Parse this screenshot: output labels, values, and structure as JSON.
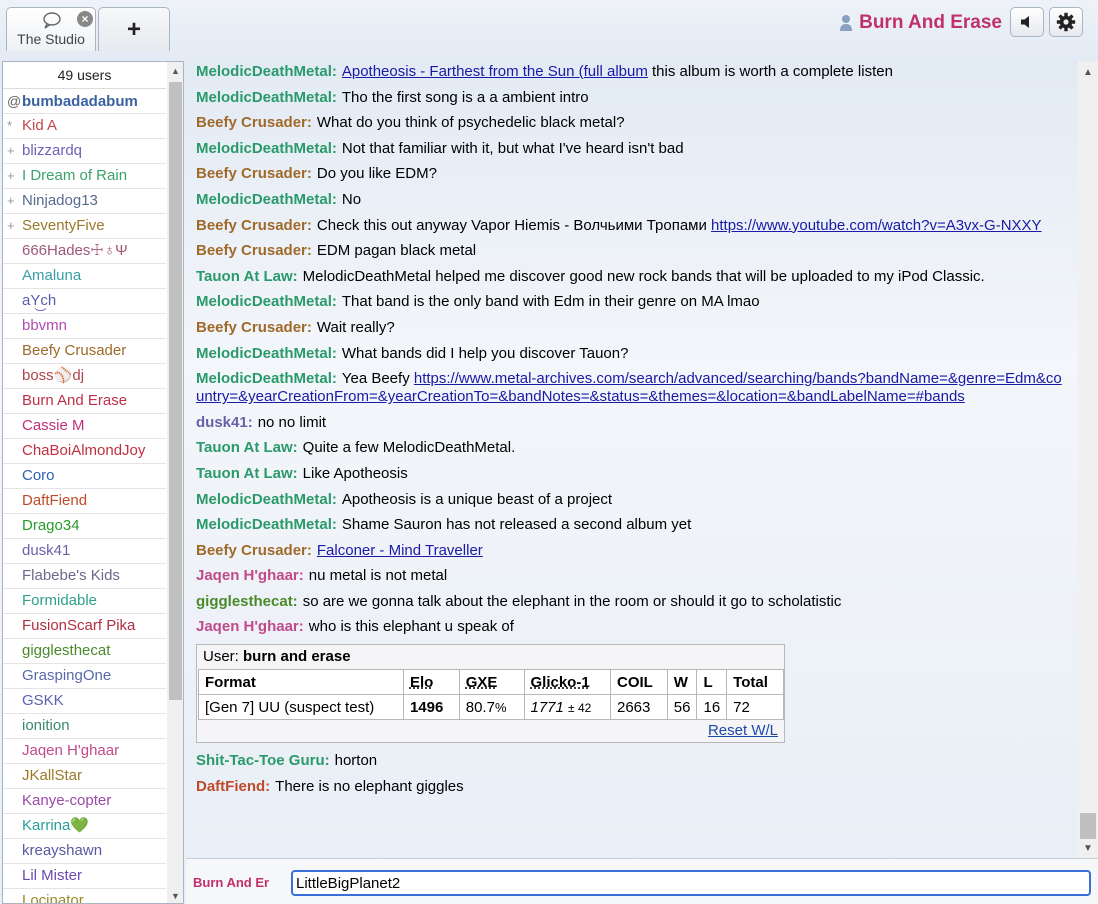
{
  "tabs": [
    {
      "label": "The Studio",
      "icon": "chat-bubble-icon",
      "close": "×"
    },
    {
      "label": "+",
      "icon": "plus-icon"
    }
  ],
  "header": {
    "username": "Burn And Erase",
    "username_color": "#c0306a",
    "sound_icon": "speaker-icon",
    "settings_icon": "gear-icon"
  },
  "userlist": {
    "count_label": "49 users",
    "users": [
      {
        "rank": "@",
        "name": "bumbadadabum",
        "color": "#3b63a0",
        "bold": true
      },
      {
        "rank": "*",
        "name": "Kid A",
        "color": "#c34848"
      },
      {
        "rank": "+",
        "name": "blizzardq",
        "color": "#6b62b8"
      },
      {
        "rank": "+",
        "name": "I Dream of Rain",
        "color": "#3aa36b"
      },
      {
        "rank": "+",
        "name": "Ninjadog13",
        "color": "#5b6a93"
      },
      {
        "rank": "+",
        "name": "SeventyFive",
        "color": "#9a7a2a"
      },
      {
        "rank": "",
        "name": "666Hades☩♁Ψ",
        "color": "#a0587a"
      },
      {
        "rank": "",
        "name": "Amaluna",
        "color": "#3aa0a8"
      },
      {
        "rank": "",
        "name": "aY͜ch",
        "color": "#5b5bb0"
      },
      {
        "rank": "",
        "name": "bbvmn",
        "color": "#b04ab0"
      },
      {
        "rank": "",
        "name": "Beefy Crusader",
        "color": "#a06a2a"
      },
      {
        "rank": "",
        "name": "boss⚾dj",
        "color": "#b0434b"
      },
      {
        "rank": "",
        "name": "Burn And Erase",
        "color": "#c0304a"
      },
      {
        "rank": "",
        "name": "Cassie M",
        "color": "#c0307a"
      },
      {
        "rank": "",
        "name": "ChaBoiAlmondJoy",
        "color": "#c03040"
      },
      {
        "rank": "",
        "name": "Coro",
        "color": "#3060b0"
      },
      {
        "rank": "",
        "name": "DaftFiend",
        "color": "#c04a2a"
      },
      {
        "rank": "",
        "name": "Drago34",
        "color": "#2a9a2a"
      },
      {
        "rank": "",
        "name": "dusk41",
        "color": "#6a62a8"
      },
      {
        "rank": "",
        "name": "Flabebe's Kids",
        "color": "#6a6a8a"
      },
      {
        "rank": "",
        "name": "Formidable",
        "color": "#30a08a"
      },
      {
        "rank": "",
        "name": "FusionScarf Pika",
        "color": "#b03040"
      },
      {
        "rank": "",
        "name": "gigglesthecat",
        "color": "#4a8a2a"
      },
      {
        "rank": "",
        "name": "GraspingOne",
        "color": "#5a6aa8"
      },
      {
        "rank": "",
        "name": "GSKK",
        "color": "#5a62b0"
      },
      {
        "rank": "",
        "name": "ionition",
        "color": "#3a8a6a"
      },
      {
        "rank": "",
        "name": "Jaqen H'ghaar",
        "color": "#c04a8a"
      },
      {
        "rank": "",
        "name": "JKallStar",
        "color": "#9a7a2a"
      },
      {
        "rank": "",
        "name": "Kanye-copter",
        "color": "#9a4aa8"
      },
      {
        "rank": "",
        "name": "Karrina💚",
        "color": "#2aa09a"
      },
      {
        "rank": "",
        "name": "kreayshawn",
        "color": "#5a5aa0"
      },
      {
        "rank": "",
        "name": "Lil Mister",
        "color": "#6a4ab0"
      },
      {
        "rank": "",
        "name": "Locinator",
        "color": "#9a8a2a"
      }
    ]
  },
  "chat": {
    "messages": [
      {
        "author": "MelodicDeathMetal:",
        "color": "#2a9a6a",
        "parts": [
          {
            "t": "link",
            "v": "Apotheosis - Farthest from the Sun (full album"
          },
          {
            "t": "text",
            "v": " this album is worth a complete listen"
          }
        ]
      },
      {
        "author": "MelodicDeathMetal:",
        "color": "#2a9a6a",
        "parts": [
          {
            "t": "text",
            "v": "Tho the first song is a a ambient intro"
          }
        ]
      },
      {
        "author": "Beefy Crusader:",
        "color": "#a06a2a",
        "parts": [
          {
            "t": "text",
            "v": "What do you think of psychedelic black metal?"
          }
        ]
      },
      {
        "author": "MelodicDeathMetal:",
        "color": "#2a9a6a",
        "parts": [
          {
            "t": "text",
            "v": "Not that familiar with it, but what I've heard isn't bad"
          }
        ]
      },
      {
        "author": "Beefy Crusader:",
        "color": "#a06a2a",
        "parts": [
          {
            "t": "text",
            "v": "Do you like EDM?"
          }
        ]
      },
      {
        "author": "MelodicDeathMetal:",
        "color": "#2a9a6a",
        "parts": [
          {
            "t": "text",
            "v": "No"
          }
        ]
      },
      {
        "author": "Beefy Crusader:",
        "color": "#a06a2a",
        "parts": [
          {
            "t": "text",
            "v": "Check this out anyway Vapor Hiemis - Волчьими Тропами "
          },
          {
            "t": "link",
            "v": "https://www.youtube.com/watch?v=A3vx-G-NXXY"
          }
        ]
      },
      {
        "author": "Beefy Crusader:",
        "color": "#a06a2a",
        "parts": [
          {
            "t": "text",
            "v": "EDM pagan black metal"
          }
        ]
      },
      {
        "author": "Tauon At Law:",
        "color": "#2a9a6a",
        "parts": [
          {
            "t": "text",
            "v": "MelodicDeathMetal helped me discover good new rock bands that will be uploaded to my iPod Classic."
          }
        ]
      },
      {
        "author": "MelodicDeathMetal:",
        "color": "#2a9a6a",
        "parts": [
          {
            "t": "text",
            "v": "That band is the only band with Edm in their genre on MA lmao"
          }
        ]
      },
      {
        "author": "Beefy Crusader:",
        "color": "#a06a2a",
        "parts": [
          {
            "t": "text",
            "v": "Wait really?"
          }
        ]
      },
      {
        "author": "MelodicDeathMetal:",
        "color": "#2a9a6a",
        "parts": [
          {
            "t": "text",
            "v": "What bands did I help you discover Tauon?"
          }
        ]
      },
      {
        "author": "MelodicDeathMetal:",
        "color": "#2a9a6a",
        "parts": [
          {
            "t": "text",
            "v": "Yea Beefy "
          },
          {
            "t": "link",
            "v": "https://www.metal-archives.com/search/advanced/searching/bands?bandName=&genre=Edm&country=&yearCreationFrom=&yearCreationTo=&bandNotes=&status=&themes=&location=&bandLabelName=#bands"
          }
        ]
      },
      {
        "author": "dusk41:",
        "color": "#6a62a8",
        "parts": [
          {
            "t": "text",
            "v": "no no limit"
          }
        ]
      },
      {
        "author": "Tauon At Law:",
        "color": "#2a9a6a",
        "parts": [
          {
            "t": "text",
            "v": "Quite a few MelodicDeathMetal."
          }
        ]
      },
      {
        "author": "Tauon At Law:",
        "color": "#2a9a6a",
        "parts": [
          {
            "t": "text",
            "v": "Like Apotheosis"
          }
        ]
      },
      {
        "author": "MelodicDeathMetal:",
        "color": "#2a9a6a",
        "parts": [
          {
            "t": "text",
            "v": "Apotheosis is a unique beast of a project"
          }
        ]
      },
      {
        "author": "MelodicDeathMetal:",
        "color": "#2a9a6a",
        "parts": [
          {
            "t": "text",
            "v": "Shame Sauron has not released a second album yet"
          }
        ]
      },
      {
        "author": "Beefy Crusader:",
        "color": "#a06a2a",
        "parts": [
          {
            "t": "link",
            "v": "Falconer - Mind Traveller"
          }
        ]
      },
      {
        "author": "Jaqen H'ghaar:",
        "color": "#c04a8a",
        "parts": [
          {
            "t": "text",
            "v": "nu metal is not metal"
          }
        ]
      },
      {
        "author": "gigglesthecat:",
        "color": "#4a8a2a",
        "parts": [
          {
            "t": "text",
            "v": "so are we gonna talk about the elephant in the room or should it go to scholatistic"
          }
        ]
      },
      {
        "author": "Jaqen H'ghaar:",
        "color": "#c04a8a",
        "parts": [
          {
            "t": "text",
            "v": "who is this elephant u speak of"
          }
        ]
      }
    ],
    "rank_table": {
      "user_label": "User:",
      "user_name": "burn and erase",
      "headers": [
        "Format",
        "Elo",
        "GXE",
        "Glicko-1",
        "COIL",
        "W",
        "L",
        "Total"
      ],
      "row": {
        "format": "[Gen 7] UU (suspect test)",
        "elo": "1496",
        "gxe": "80.7",
        "gxe_unit": "%",
        "glicko": "1771",
        "glicko_pm": "± 42",
        "coil": "2663",
        "w": "56",
        "l": "16",
        "total": "72"
      },
      "reset_label": "Reset W/L"
    },
    "after_messages": [
      {
        "author": "Shit-Tac-Toe Guru:",
        "color": "#2a9a6a",
        "parts": [
          {
            "t": "text",
            "v": "horton"
          }
        ]
      },
      {
        "author": "DaftFiend:",
        "color": "#c04a2a",
        "parts": [
          {
            "t": "text",
            "v": "There is no elephant giggles"
          }
        ]
      }
    ]
  },
  "input": {
    "name_label": "Burn And Er",
    "value": "LittleBigPlanet2"
  }
}
